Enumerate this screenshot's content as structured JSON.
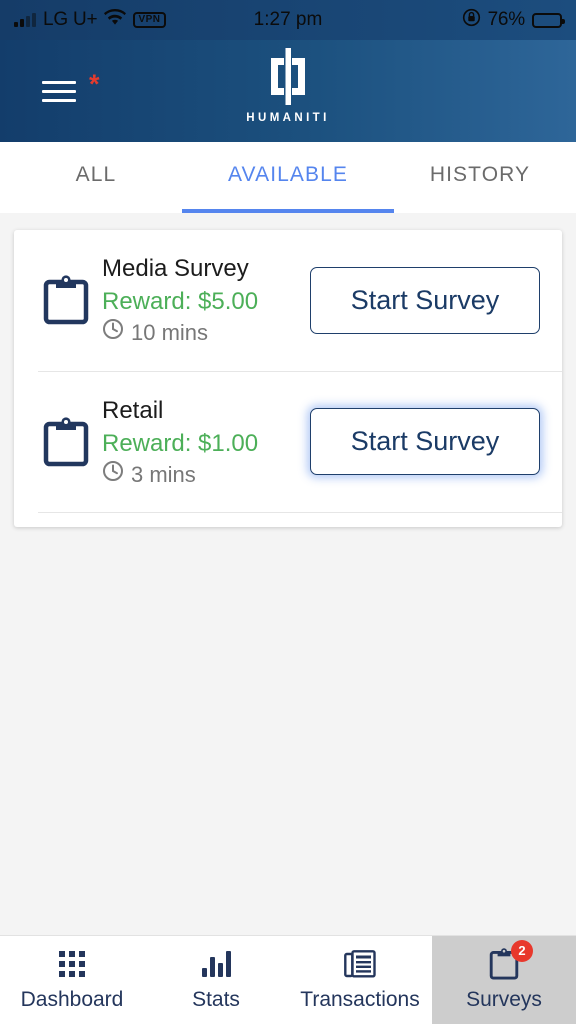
{
  "status_bar": {
    "carrier": "LG U+",
    "vpn_label": "VPN",
    "time": "1:27 pm",
    "battery_percent": "76%"
  },
  "header": {
    "brand_name": "HUMANITI",
    "menu_icon": "hamburger-menu-icon",
    "notification_mark": "*",
    "gradient_from": "#133d6b",
    "gradient_to": "#2e6699"
  },
  "tabs": {
    "active_color": "#5585ee",
    "items": [
      {
        "label": "ALL",
        "active": false
      },
      {
        "label": "AVAILABLE",
        "active": true
      },
      {
        "label": "HISTORY",
        "active": false
      }
    ]
  },
  "surveys": {
    "reward_color": "#4caf58",
    "items": [
      {
        "title": "Media Survey",
        "reward": "Reward: $5.00",
        "duration": "10 mins",
        "button_label": "Start Survey",
        "button_focused": false
      },
      {
        "title": "Retail",
        "reward": "Reward: $1.00",
        "duration": "3 mins",
        "button_label": "Start Survey",
        "button_focused": true
      }
    ]
  },
  "bottom_nav": {
    "items": [
      {
        "label": "Dashboard",
        "icon": "grid-icon",
        "active": false,
        "badge": ""
      },
      {
        "label": "Stats",
        "icon": "bar-chart-icon",
        "active": false,
        "badge": ""
      },
      {
        "label": "Transactions",
        "icon": "newspaper-icon",
        "active": false,
        "badge": ""
      },
      {
        "label": "Surveys",
        "icon": "clipboard-icon",
        "active": true,
        "badge": "2"
      }
    ]
  }
}
